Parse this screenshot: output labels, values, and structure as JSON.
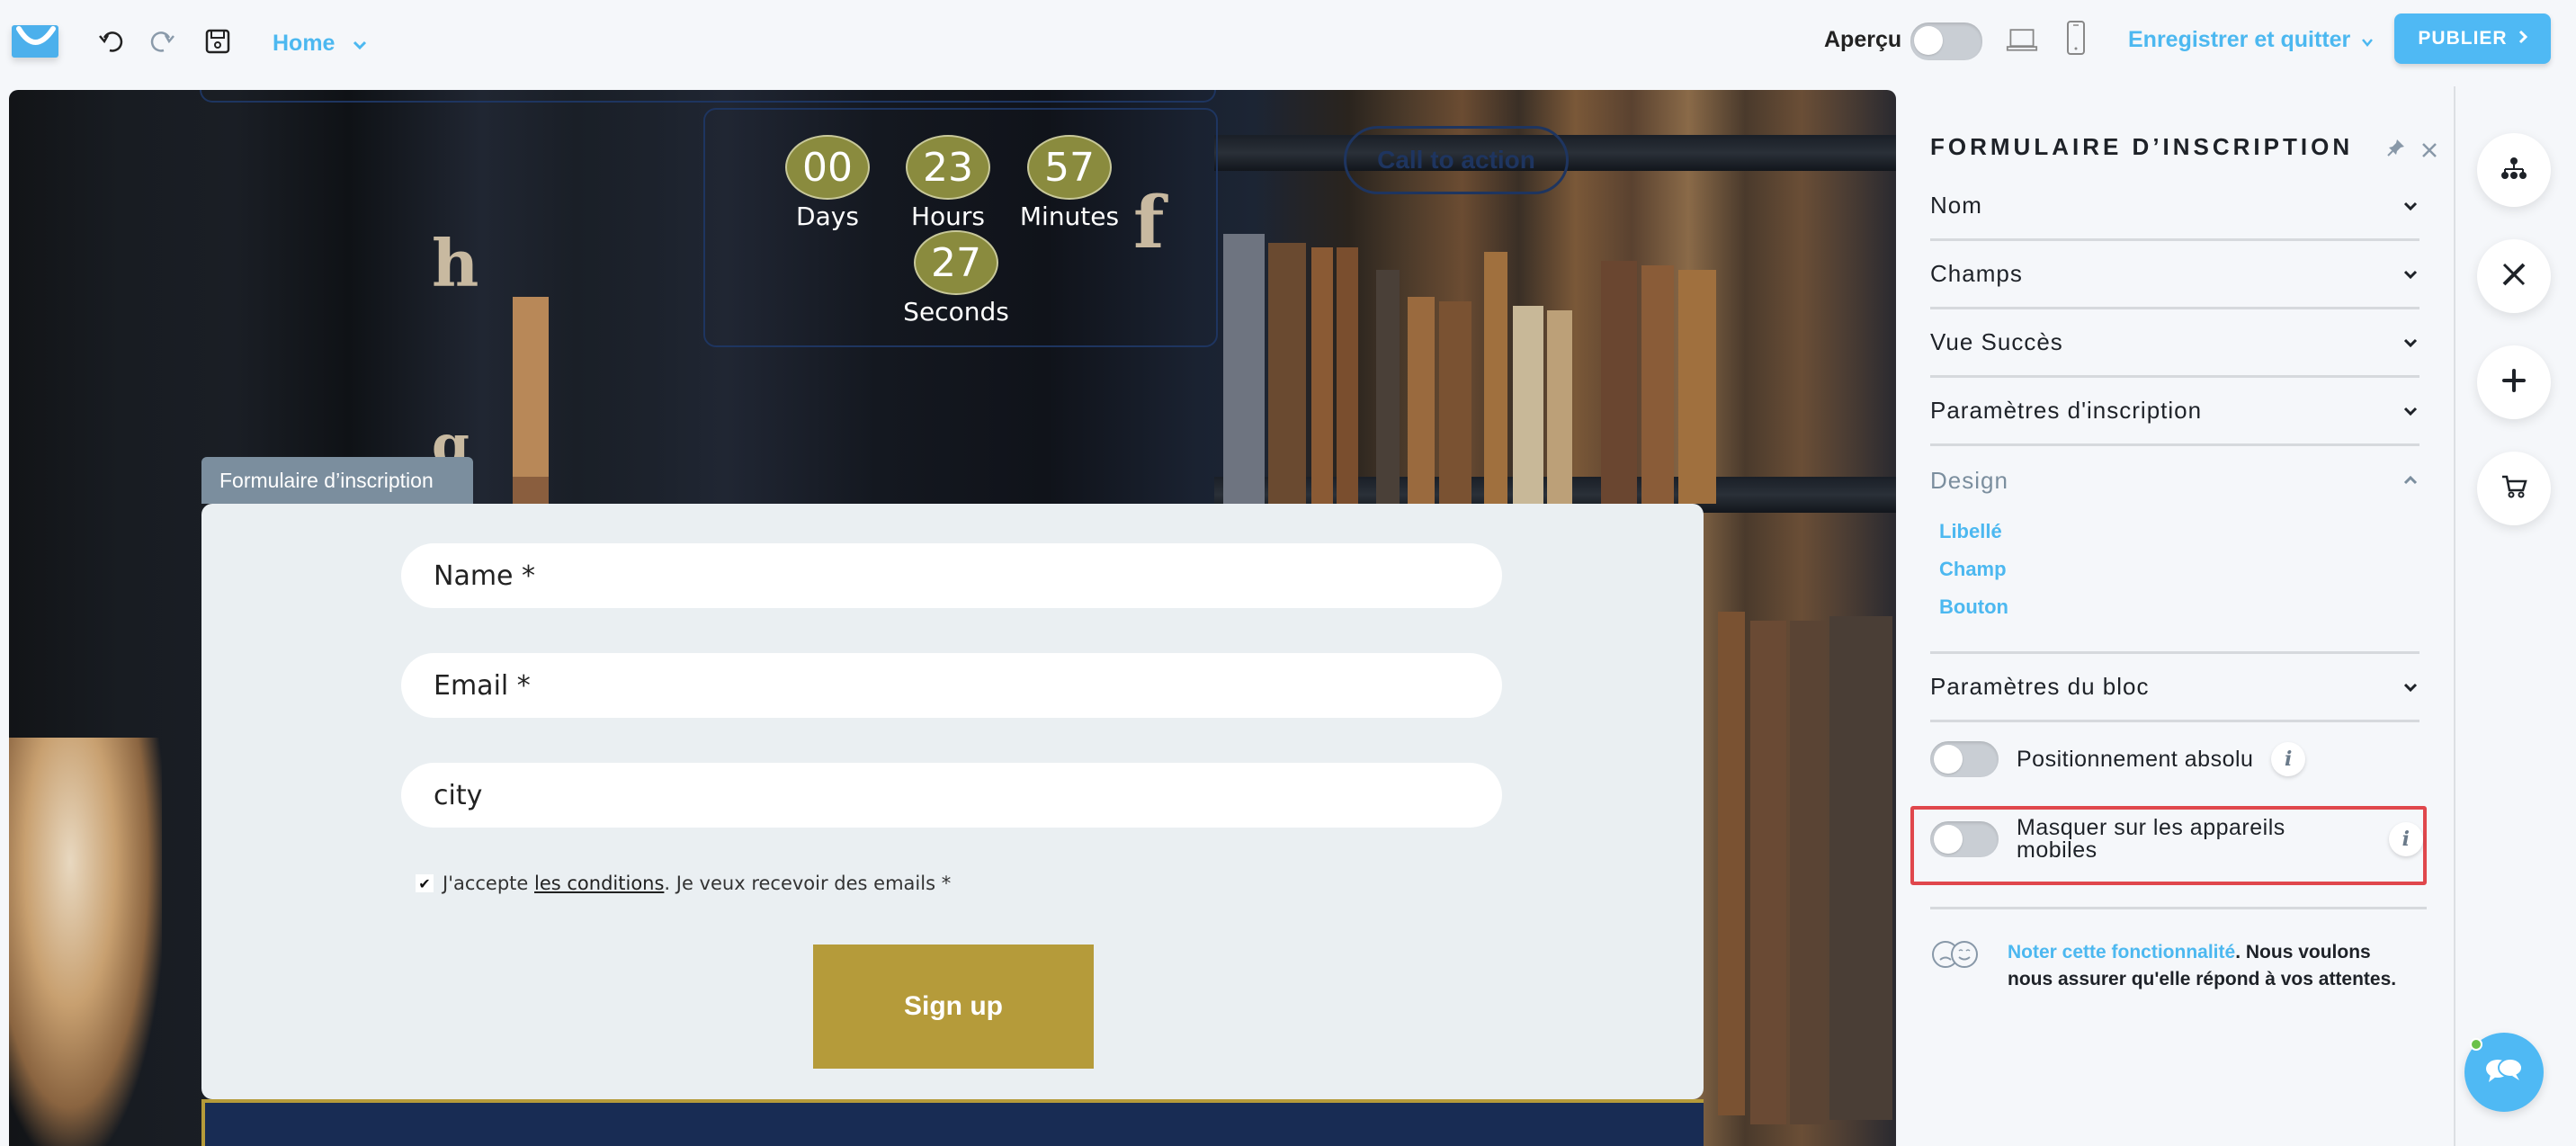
{
  "topbar": {
    "page_selector": "Home",
    "preview_label": "Aperçu",
    "preview_enabled": false,
    "save_quit_label": "Enregistrer et quitter",
    "publish_label": "PUBLIER"
  },
  "canvas": {
    "background_letters": [
      "h",
      "g",
      "f"
    ],
    "countdown": {
      "days": {
        "value": "00",
        "label": "Days"
      },
      "hours": {
        "value": "23",
        "label": "Hours"
      },
      "minutes": {
        "value": "57",
        "label": "Minutes"
      },
      "seconds": {
        "value": "27",
        "label": "Seconds"
      }
    },
    "cta_label": "Call to action",
    "form": {
      "tab_label": "Formulaire d’inscription",
      "fields": [
        {
          "placeholder": "Name *"
        },
        {
          "placeholder": "Email *"
        },
        {
          "placeholder": "city"
        }
      ],
      "consent": {
        "checked": true,
        "prefix": "J'accepte ",
        "link": "les conditions",
        "suffix": ". Je veux recevoir des emails *"
      },
      "submit_label": "Sign up"
    }
  },
  "sidebar": {
    "title": "FORMULAIRE D’INSCRIPTION",
    "sections": [
      {
        "label": "Nom"
      },
      {
        "label": "Champs"
      },
      {
        "label": "Vue Succès"
      },
      {
        "label": "Paramètres d'inscription"
      },
      {
        "label": "Design"
      },
      {
        "label": "Paramètres du bloc"
      }
    ],
    "design_items": [
      "Libellé",
      "Champ",
      "Bouton"
    ],
    "toggles": [
      {
        "label": "Positionnement absolu",
        "enabled": false
      },
      {
        "label": "Masquer sur les appareils mobiles",
        "enabled": false
      }
    ],
    "feedback": {
      "link": "Noter cette fonctionnalité",
      "text": ". Nous voulons nous assurer qu'elle répond à vos attentes."
    }
  },
  "colors": {
    "accent": "#4fb9f4",
    "countdown": "#8a8b3e",
    "submit": "#b59b3a",
    "highlight": "#e0474c",
    "navy": "#182c54"
  }
}
